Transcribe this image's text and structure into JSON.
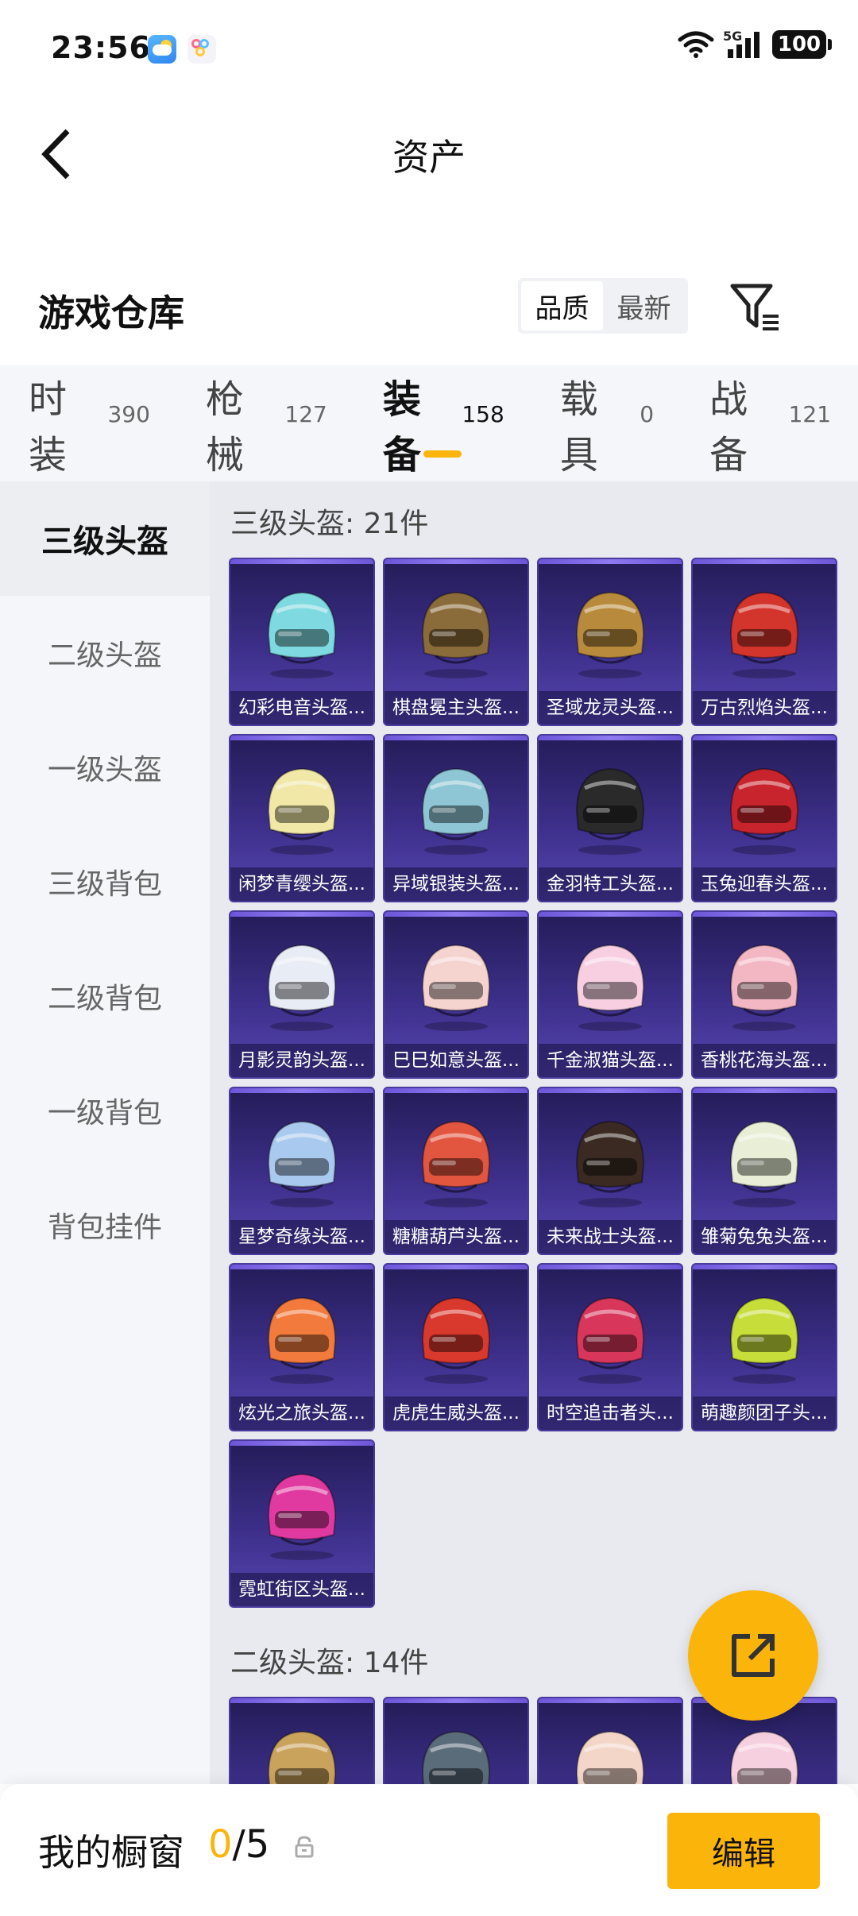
{
  "status_bar": {
    "time": "23:56",
    "network": "5G",
    "battery": "100"
  },
  "nav": {
    "title": "资产"
  },
  "warehouse": {
    "title": "游戏仓库",
    "sort_options": [
      "品质",
      "最新"
    ],
    "active_sort": "品质"
  },
  "tabs": [
    {
      "label": "时装",
      "count": "390"
    },
    {
      "label": "枪械",
      "count": "127"
    },
    {
      "label": "装备",
      "count": "158",
      "active": true
    },
    {
      "label": "载具",
      "count": "0"
    },
    {
      "label": "战备",
      "count": "121"
    }
  ],
  "sidebar": {
    "items": [
      {
        "label": "三级头盔",
        "active": true
      },
      {
        "label": "二级头盔"
      },
      {
        "label": "一级头盔"
      },
      {
        "label": "三级背包"
      },
      {
        "label": "二级背包"
      },
      {
        "label": "一级背包"
      },
      {
        "label": "背包挂件"
      }
    ]
  },
  "sections": [
    {
      "title": "三级头盔: 21件",
      "items": [
        {
          "name": "幻彩电音头盔...",
          "color": "#7fd9e0"
        },
        {
          "name": "棋盘冕主头盔...",
          "color": "#8a6b3a"
        },
        {
          "name": "圣域龙灵头盔...",
          "color": "#b88a3c"
        },
        {
          "name": "万古烈焰头盔...",
          "color": "#d3342c"
        },
        {
          "name": "闲梦青缨头盔...",
          "color": "#f1e7a6"
        },
        {
          "name": "异域银装头盔...",
          "color": "#8fc6d6"
        },
        {
          "name": "金羽特工头盔...",
          "color": "#2a2a2a"
        },
        {
          "name": "玉兔迎春头盔...",
          "color": "#c8242d"
        },
        {
          "name": "月影灵韵头盔...",
          "color": "#e8ecf5"
        },
        {
          "name": "巳巳如意头盔...",
          "color": "#f5d3cf"
        },
        {
          "name": "千金淑猫头盔...",
          "color": "#f7cfe0"
        },
        {
          "name": "香桃花海头盔...",
          "color": "#f3b7c4"
        },
        {
          "name": "星梦奇缘头盔...",
          "color": "#a9c9ee"
        },
        {
          "name": "糖糖葫芦头盔...",
          "color": "#e2553f"
        },
        {
          "name": "未来战士头盔...",
          "color": "#3a2a22"
        },
        {
          "name": "雏菊兔兔头盔...",
          "color": "#e8efd6"
        },
        {
          "name": "炫光之旅头盔...",
          "color": "#f27a3c"
        },
        {
          "name": "虎虎生威头盔...",
          "color": "#d9382c"
        },
        {
          "name": "时空追击者头...",
          "color": "#d8365a"
        },
        {
          "name": "萌趣颜团子头...",
          "color": "#c6dd3a"
        },
        {
          "name": "霓虹街区头盔...",
          "color": "#e03aa0"
        }
      ]
    },
    {
      "title": "二级头盔: 14件",
      "items": [
        {
          "name": "",
          "color": "#c9a25c"
        },
        {
          "name": "",
          "color": "#5a6b7a"
        },
        {
          "name": "",
          "color": "#f3d6c8"
        },
        {
          "name": "",
          "color": "#f7d0df"
        }
      ]
    }
  ],
  "bottom_bar": {
    "label": "我的橱窗",
    "count_current": "0",
    "count_sep": "/",
    "count_total": "5",
    "edit_label": "编辑"
  },
  "colors": {
    "accent": "#fbb40a",
    "card_bg": "#3d2f8a"
  },
  "icons": [
    "back-arrow-icon",
    "filter-icon",
    "lock-icon",
    "share-out-icon"
  ]
}
